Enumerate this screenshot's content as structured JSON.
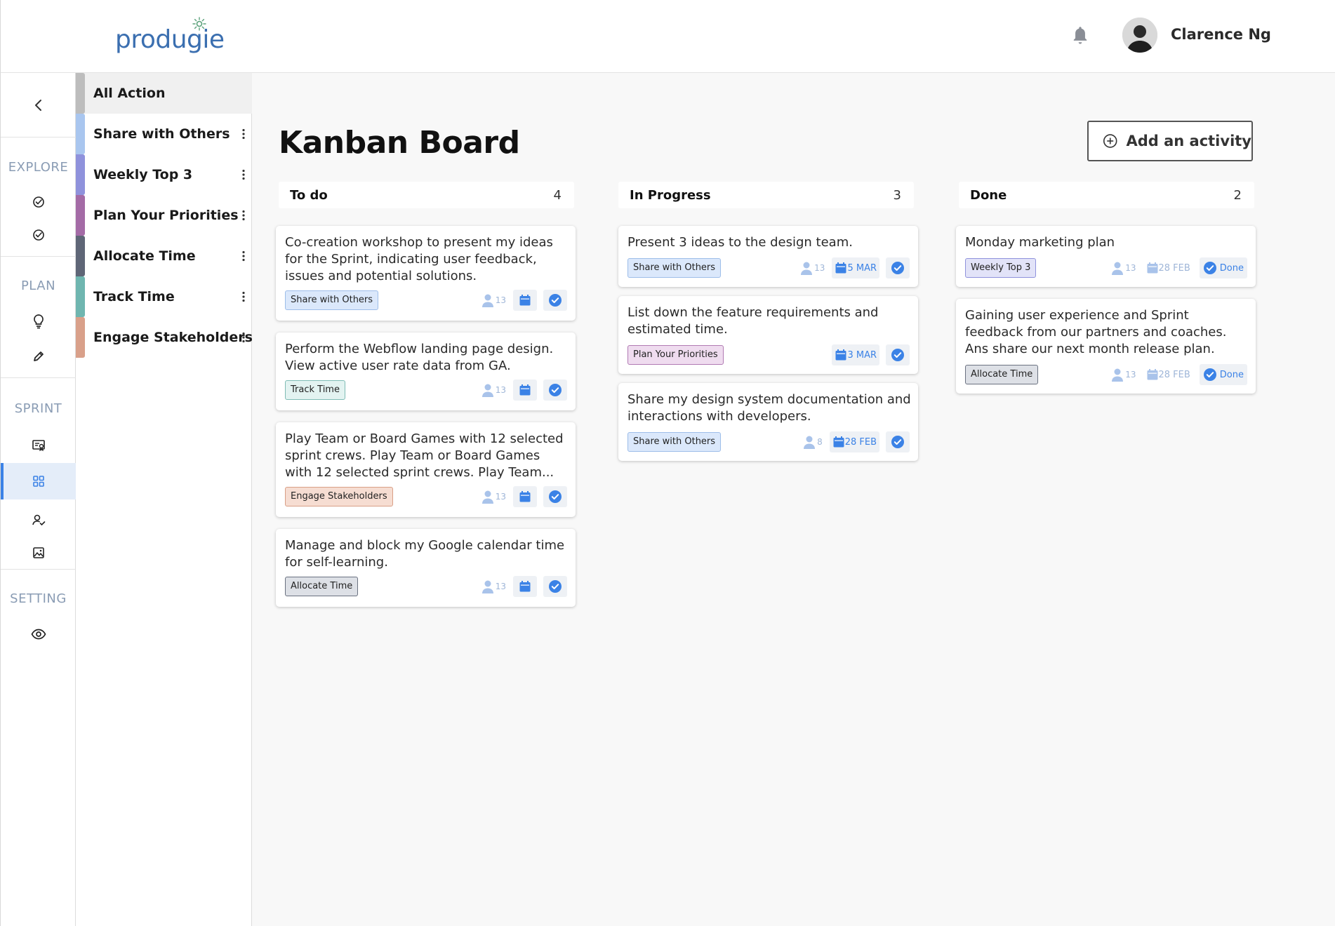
{
  "brand": {
    "name": "produgie"
  },
  "user": {
    "name": "Clarence Ng"
  },
  "rail": {
    "sections": [
      {
        "label": "EXPLORE",
        "icons": [
          "check-circle-icon",
          "check-circle-icon"
        ]
      },
      {
        "label": "PLAN",
        "icons": [
          "lightbulb-icon",
          "pencil-icon"
        ]
      },
      {
        "label": "SPRINT",
        "icons": [
          "certificate-icon",
          "grid-icon",
          "user-check-icon",
          "image-icon"
        ]
      },
      {
        "label": "SETTING",
        "icons": [
          "eye-icon"
        ]
      }
    ]
  },
  "categories": [
    {
      "label": "All Action",
      "color": "#bdbdbd"
    },
    {
      "label": "Share with Others",
      "color": "#a9c6ef"
    },
    {
      "label": "Weekly Top 3",
      "color": "#8f92dc"
    },
    {
      "label": "Plan Your Priorities",
      "color": "#a46ba6"
    },
    {
      "label": "Allocate Time",
      "color": "#5f6677"
    },
    {
      "label": "Track Time",
      "color": "#6fb6b0"
    },
    {
      "label": "Engage Stakeholders",
      "color": "#d9a08a"
    }
  ],
  "page": {
    "title": "Kanban Board",
    "add_label": "Add an activity"
  },
  "columns": [
    {
      "name": "To do",
      "count": "4",
      "cards": [
        {
          "text": "Co-creation workshop to present my ideas for the Sprint, indicating user feedback, issues and potential solutions.",
          "tag": "Share with Others",
          "people": "13",
          "date": "",
          "status": ""
        },
        {
          "text": "Perform the Webflow landing page design. View active user rate data from GA.",
          "tag": "Track Time",
          "people": "13",
          "date": "",
          "status": ""
        },
        {
          "text": "Play Team or Board Games with 12 selected sprint crews. Play Team or Board Games with 12 selected sprint crews. Play Team...",
          "tag": "Engage Stakeholders",
          "people": "13",
          "date": "",
          "status": ""
        },
        {
          "text": "Manage and block my Google calendar time for self-learning.",
          "tag": "Allocate Time",
          "people": "13",
          "date": "",
          "status": ""
        }
      ]
    },
    {
      "name": "In Progress",
      "count": "3",
      "cards": [
        {
          "text": "Present 3 ideas to the design team.",
          "tag": "Share with Others",
          "people": "13",
          "date": "5 MAR",
          "status": ""
        },
        {
          "text": "List down the feature requirements and estimated time.",
          "tag": "Plan Your Priorities",
          "people": "",
          "date": "3 MAR",
          "status": ""
        },
        {
          "text": "Share my design system documentation and interactions with developers.",
          "tag": "Share with Others",
          "people": "8",
          "date": "28 FEB",
          "status": ""
        }
      ]
    },
    {
      "name": "Done",
      "count": "2",
      "cards": [
        {
          "text": "Monday marketing plan",
          "tag": "Weekly Top 3",
          "people": "13",
          "date": "28 FEB",
          "status": "Done"
        },
        {
          "text": "Gaining user experience and Sprint feedback from our partners and coaches. Ans share our next month release plan.",
          "tag": "Allocate Time",
          "people": "13",
          "date": "28 FEB",
          "status": "Done"
        }
      ]
    }
  ],
  "tag_styles": {
    "Share with Others": {
      "bg": "#dbe8fb",
      "border": "#9dbde9"
    },
    "Track Time": {
      "bg": "#e3f3f1",
      "border": "#7fbcb5"
    },
    "Engage Stakeholders": {
      "bg": "#f6ddd2",
      "border": "#d99f86"
    },
    "Allocate Time": {
      "bg": "#dde0e6",
      "border": "#6a7180"
    },
    "Plan Your Priorities": {
      "bg": "#efdcef",
      "border": "#b17ab3"
    },
    "Weekly Top 3": {
      "bg": "#e2e3f8",
      "border": "#8f92dc"
    }
  },
  "accent": "#3b82e6"
}
